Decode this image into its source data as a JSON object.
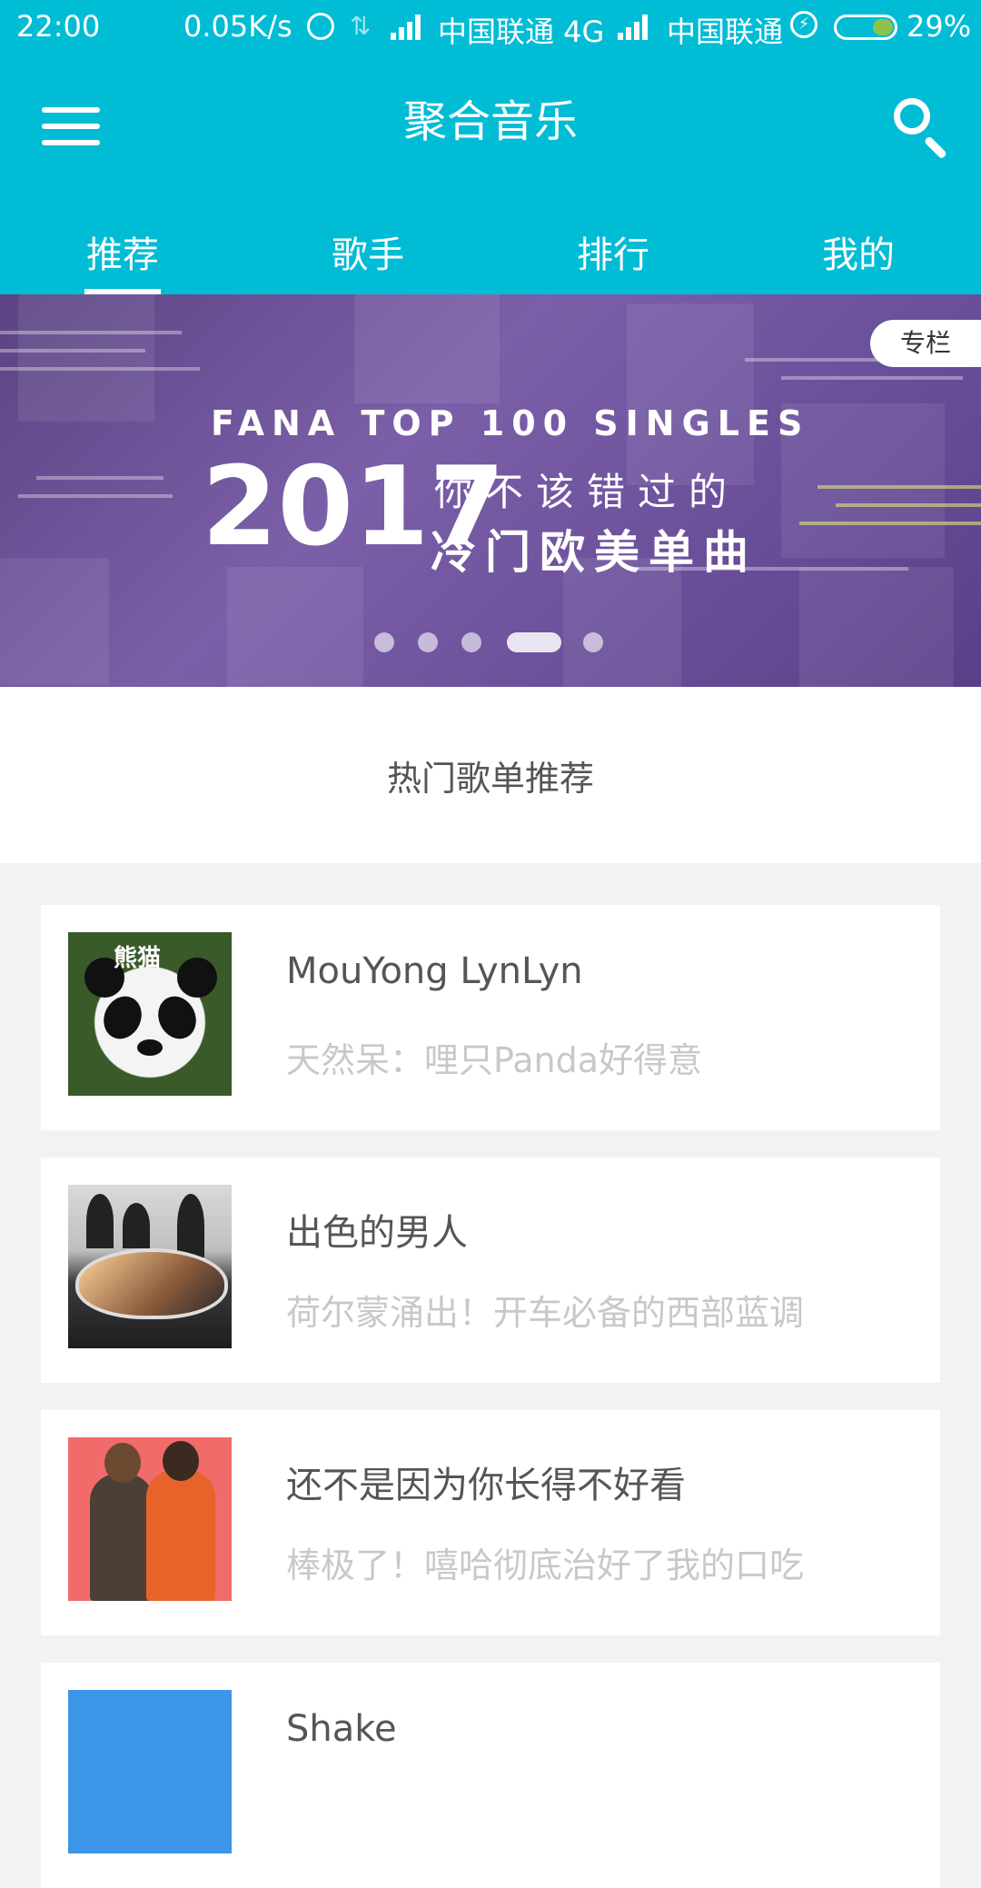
{
  "status_bar": {
    "time": "22:00",
    "net_speed": "0.05K/s",
    "carrier1": "中国联通 4G",
    "carrier2": "中国联通",
    "battery": "29%",
    "battery_level": 0.29,
    "icons": [
      "alarm-icon",
      "data-arrows-icon",
      "signal-icon",
      "signal-icon",
      "charging-icon",
      "battery-icon"
    ]
  },
  "appbar": {
    "title": "聚合音乐",
    "menu_icon": "menu-icon",
    "search_icon": "search-icon",
    "color": "#00bcd4"
  },
  "tabs": [
    {
      "label": "推荐",
      "active": true
    },
    {
      "label": "歌手",
      "active": false
    },
    {
      "label": "排行",
      "active": false
    },
    {
      "label": "我的",
      "active": false
    }
  ],
  "banner": {
    "badge": "专栏",
    "subtitle": "FANA TOP 100 SINGLES",
    "year": "2017",
    "line1": "你不该错过的",
    "line2": "冷门欧美单曲",
    "page_count": 5,
    "active_page": 4
  },
  "section": {
    "title": "热门歌单推荐"
  },
  "playlists": [
    {
      "name": "MouYong LynLyn",
      "desc": "天然呆：哩只Panda好得意",
      "cover_caption": "熊猫"
    },
    {
      "name": "出色的男人",
      "desc": "荷尔蒙涌出！开车必备的西部蓝调"
    },
    {
      "name": "还不是因为你长得不好看",
      "desc": "棒极了！嘻哈彻底治好了我的口吃"
    },
    {
      "name": "Shake",
      "desc": ""
    }
  ]
}
